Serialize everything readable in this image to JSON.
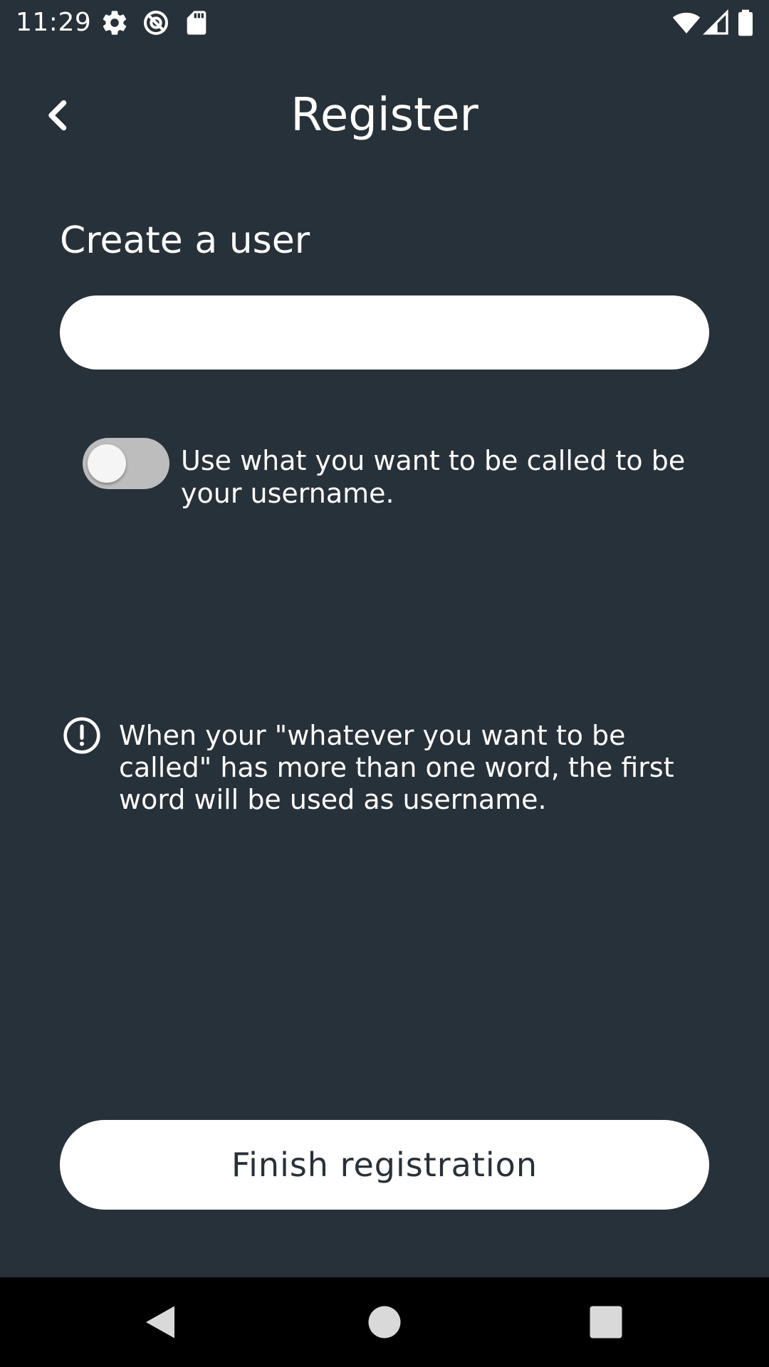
{
  "status_bar": {
    "time": "11:29",
    "left_icons": [
      "gear-icon",
      "sync-disabled-icon",
      "sd-card-icon"
    ],
    "right_icons": [
      "wifi-icon",
      "cell-signal-icon",
      "battery-icon"
    ]
  },
  "toolbar": {
    "back_icon": "chevron-left-icon",
    "title": "Register"
  },
  "form": {
    "heading": "Create a user",
    "username_input": {
      "value": "",
      "placeholder": ""
    },
    "toggle": {
      "checked": false,
      "label": "Use what you want to be called to be your username."
    },
    "info": {
      "icon": "alert-circle-icon",
      "text": "When your \"whatever you want to be called\" has more than one word, the first word will be used as username."
    },
    "finish_button_label": "Finish registration"
  },
  "nav_bar": {
    "buttons": [
      "back-triangle-icon",
      "home-circle-icon",
      "recents-square-icon"
    ]
  },
  "colors": {
    "background": "#273139",
    "foreground": "#ffffff",
    "toggle_track": "#bdbdbd",
    "nav_bar": "#000000"
  }
}
